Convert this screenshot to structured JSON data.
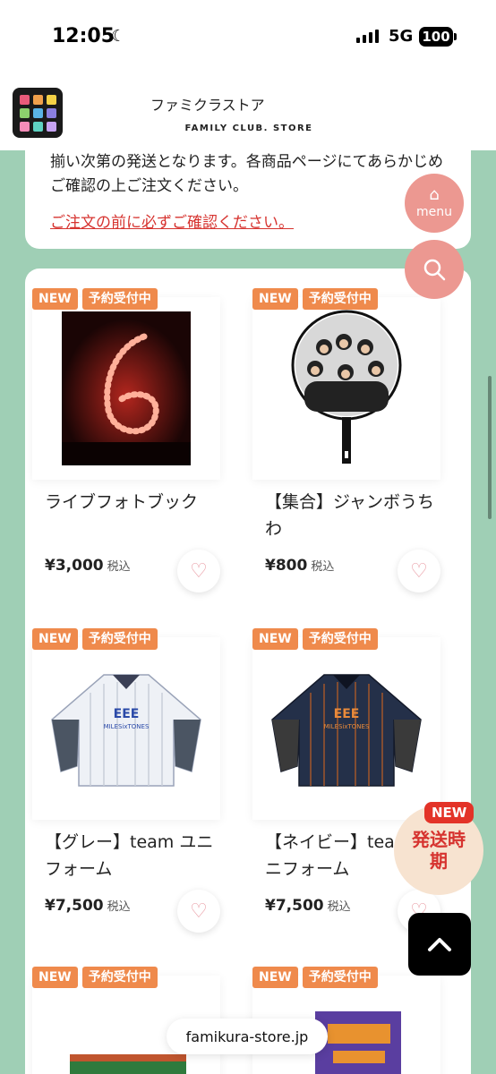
{
  "status": {
    "time": "12:05",
    "network": "5G",
    "battery": "100"
  },
  "header": {
    "logo_text": "ファミクラストア",
    "logo_sub": "FAMILY CLUB. STORE"
  },
  "notice": {
    "line1": "揃い次第の発送となります。各商品ページにてあらかじめ",
    "line2": "ご確認の上ご注文ください。",
    "warning_link": "ご注文の前に必ずご確認ください。"
  },
  "fabs": {
    "menu_label": "menu",
    "ship_label": "発送時期",
    "ship_badge": "NEW"
  },
  "badges": {
    "new": "NEW",
    "preorder": "予約受付中"
  },
  "products": [
    {
      "name": "ライブフォトブック",
      "price": "¥3,000",
      "tax": "税込"
    },
    {
      "name": "【集合】ジャンボうちわ",
      "price": "¥800",
      "tax": "税込"
    },
    {
      "name": "【グレー】team ユニフォーム",
      "price": "¥7,500",
      "tax": "税込"
    },
    {
      "name": "【ネイビー】team ユニフォーム",
      "price": "¥7,500",
      "tax": "税込"
    }
  ],
  "url_bar": {
    "url": "famikura-store.jp"
  },
  "colors": {
    "background": "#9fcfb5",
    "badge": "#ef8a4c",
    "accent_red": "#d6332f",
    "fab_pink": "#ec9891"
  }
}
